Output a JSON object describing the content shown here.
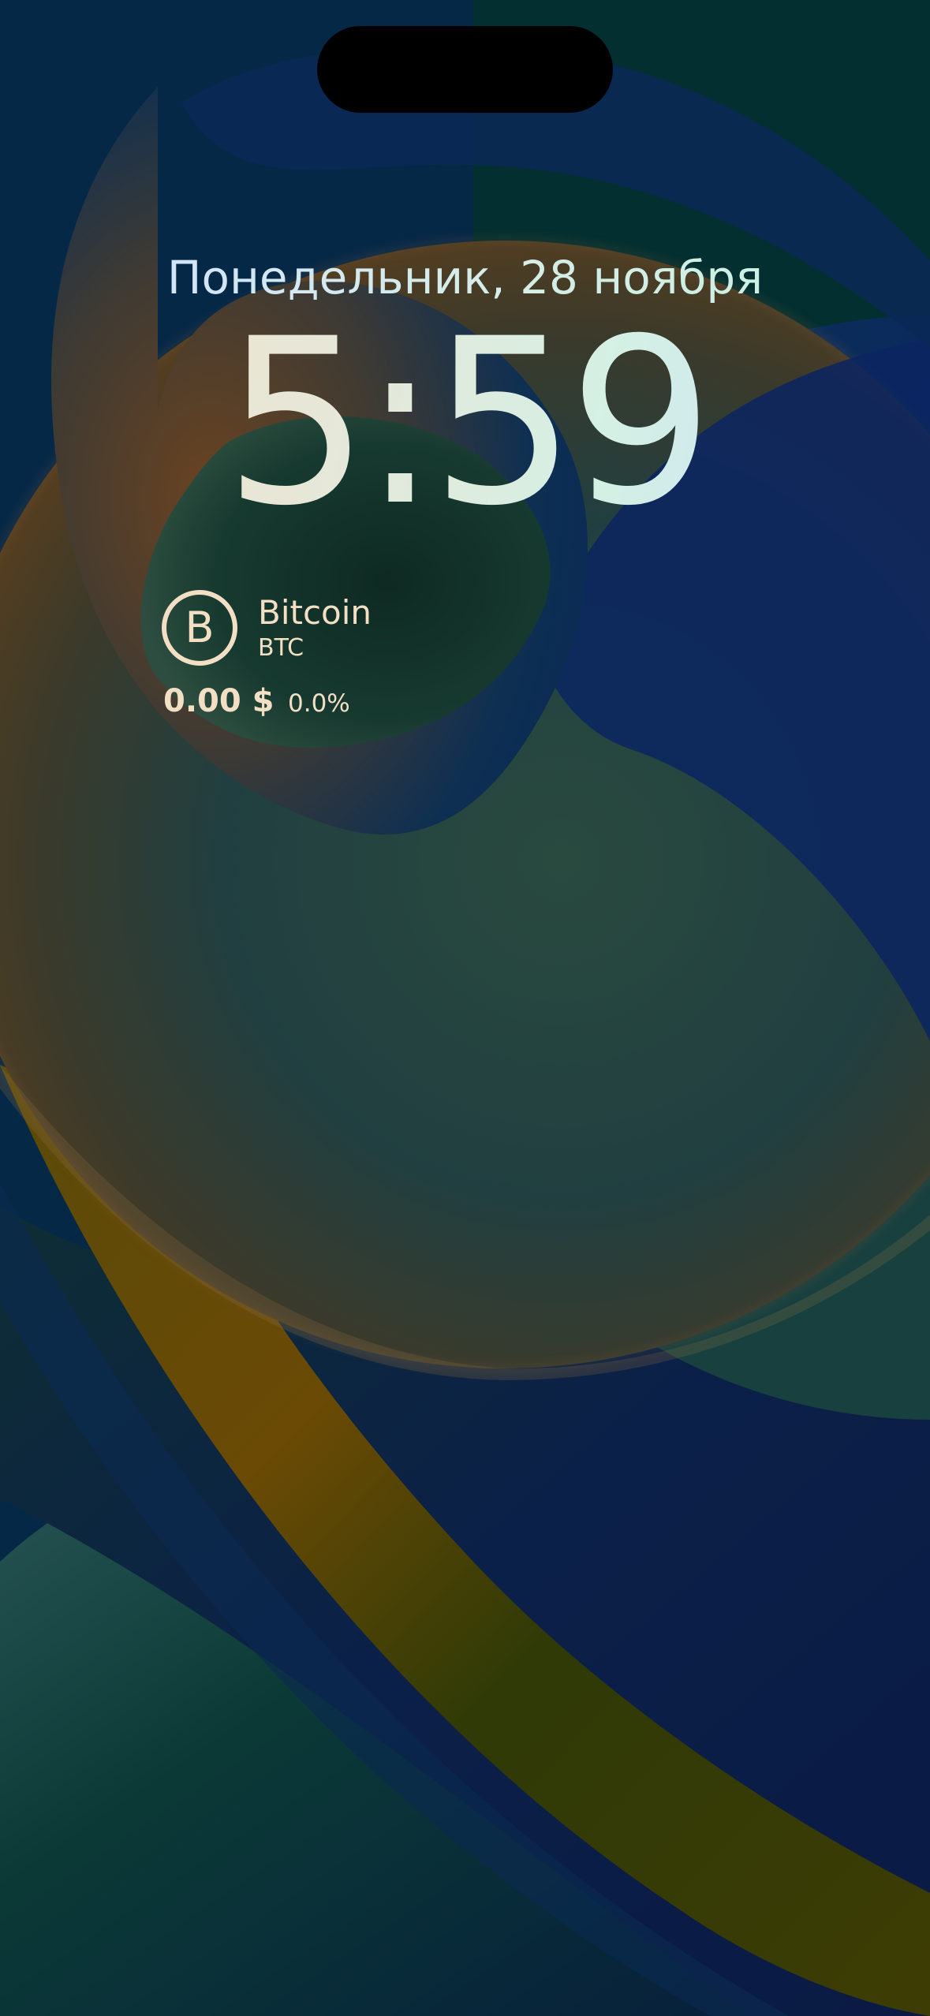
{
  "lock_screen": {
    "date": "Понедельник, 28 ноября",
    "time": "5:59"
  },
  "widget": {
    "icon": "bitcoin-icon",
    "icon_glyph": "B",
    "coin_name": "Bitcoin",
    "ticker": "BTC",
    "price": "0.00 $",
    "change": "0.0%"
  },
  "colors": {
    "widget_text": "#f2dfc4",
    "background_base": "#052a45"
  }
}
